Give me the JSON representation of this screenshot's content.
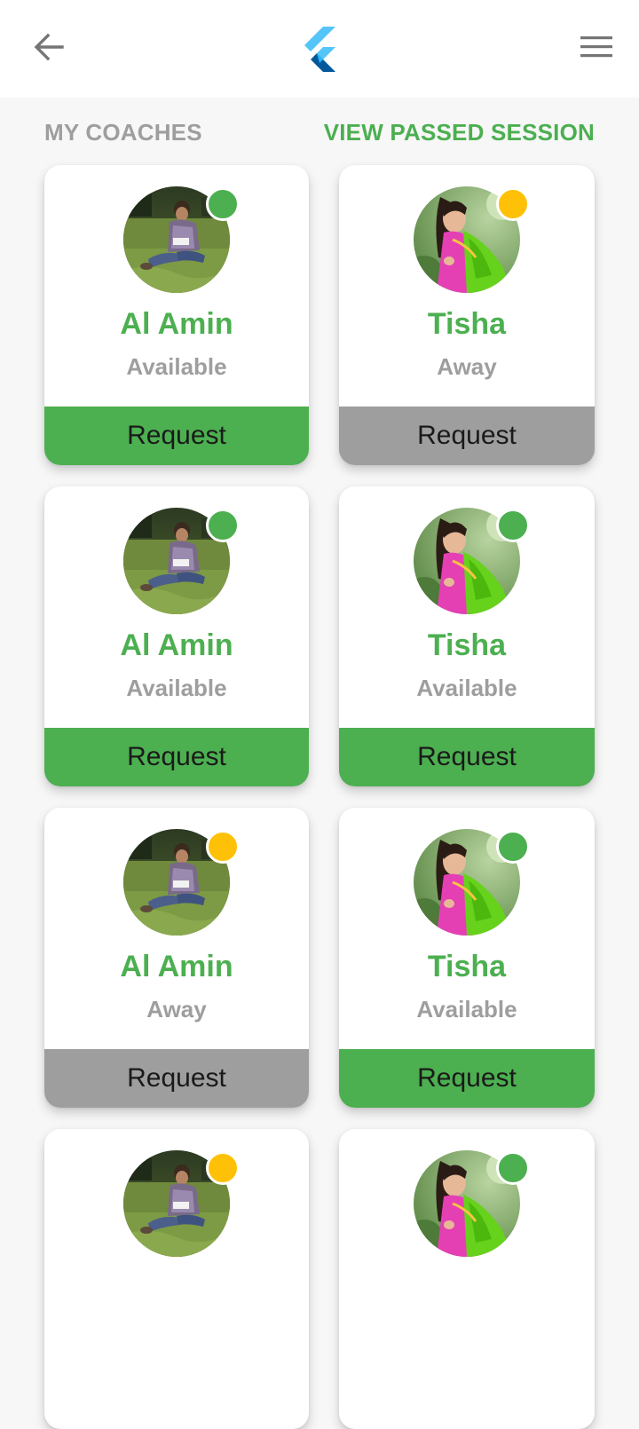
{
  "app": {
    "back_icon": "arrow-left-icon",
    "logo_icon": "flutter-logo-icon",
    "menu_icon": "hamburger-menu-icon"
  },
  "section": {
    "title": "MY COACHES",
    "link": "VIEW PASSED SESSION"
  },
  "colors": {
    "primary": "#4caf50",
    "inactive": "#9e9e9e",
    "available": "#4caf50",
    "away": "#ffc107"
  },
  "coaches": [
    {
      "name": "Al Amin",
      "status": "Available",
      "dot": "available",
      "button_label": "Request",
      "button_state": "active",
      "avatar": "man-reading-on-grass-photo"
    },
    {
      "name": "Tisha",
      "status": "Away",
      "dot": "away",
      "button_label": "Request",
      "button_state": "inactive",
      "avatar": "woman-in-green-saree-photo"
    },
    {
      "name": "Al Amin",
      "status": "Available",
      "dot": "available",
      "button_label": "Request",
      "button_state": "active",
      "avatar": "man-reading-on-grass-photo"
    },
    {
      "name": "Tisha",
      "status": "Available",
      "dot": "available",
      "button_label": "Request",
      "button_state": "active",
      "avatar": "woman-in-green-saree-photo"
    },
    {
      "name": "Al Amin",
      "status": "Away",
      "dot": "away",
      "button_label": "Request",
      "button_state": "inactive",
      "avatar": "man-reading-on-grass-photo"
    },
    {
      "name": "Tisha",
      "status": "Available",
      "dot": "available",
      "button_label": "Request",
      "button_state": "active",
      "avatar": "woman-in-green-saree-photo"
    },
    {
      "dot": "away",
      "avatar": "man-reading-on-grass-photo"
    },
    {
      "dot": "available",
      "avatar": "woman-in-green-saree-photo"
    }
  ]
}
